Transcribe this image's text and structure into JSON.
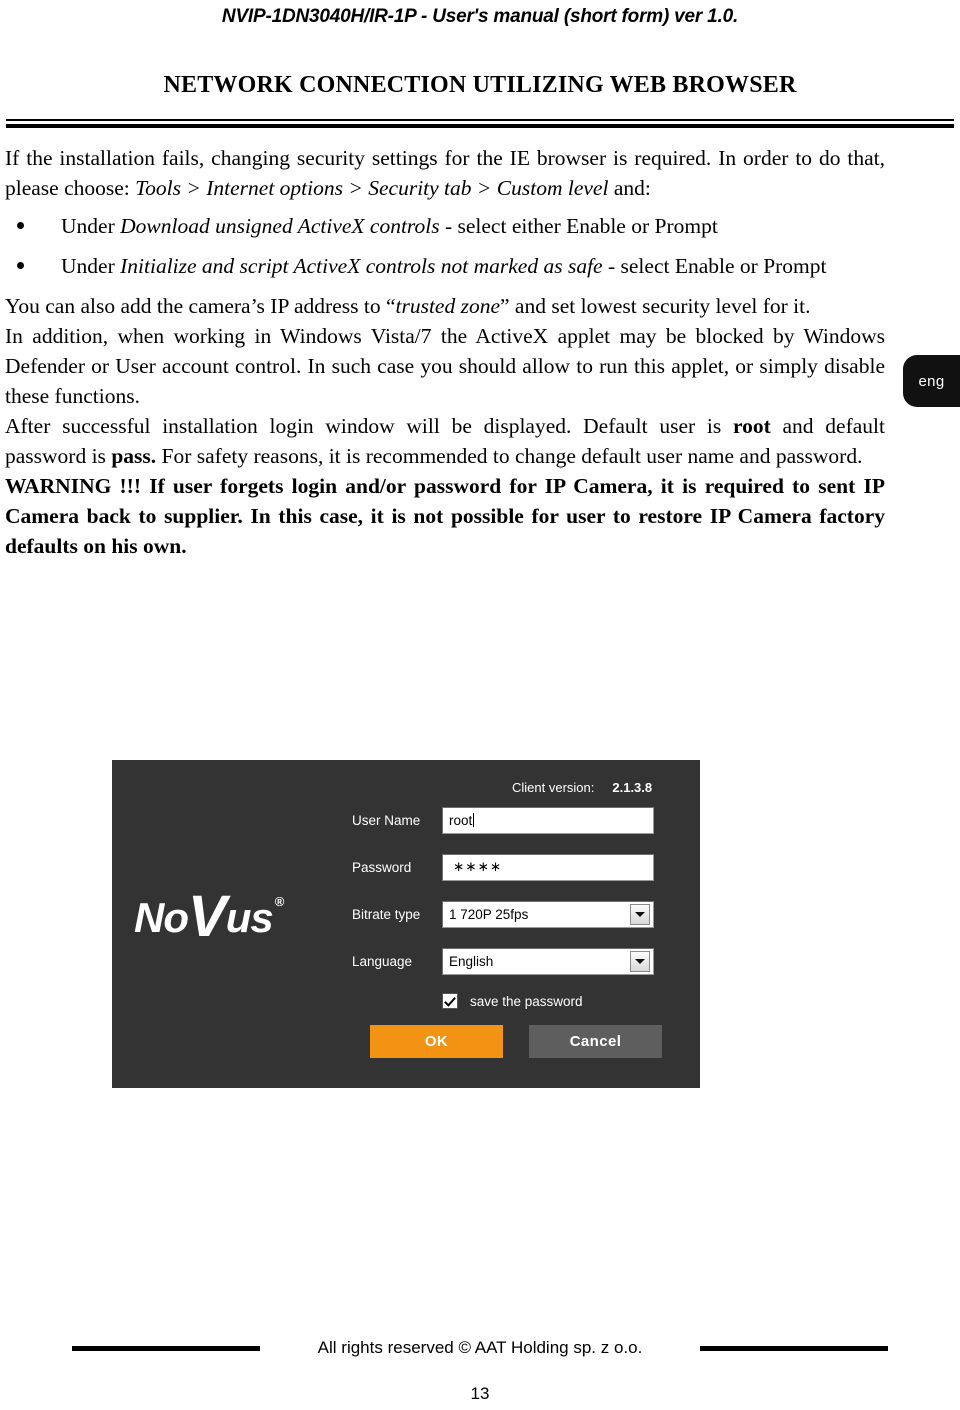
{
  "header": {
    "running_title": "NVIP-1DN3040H/IR-1P - User's manual (short form) ver 1.0."
  },
  "section": {
    "title": "NETWORK CONNECTION UTILIZING WEB BROWSER"
  },
  "body": {
    "intro_part1": "If the installation fails, changing security settings for the IE browser is required. In order to do that, please choose: ",
    "intro_menu_path": "Tools > Internet options > Security tab > Custom level",
    "intro_part2": " and:",
    "bullets": [
      {
        "prefix": "Under ",
        "emphasis": "Download unsigned ActiveX controls",
        "suffix": " - select either Enable or Prompt"
      },
      {
        "prefix": "Under ",
        "emphasis": "Initialize and script ActiveX controls not marked as safe",
        "suffix": " - select Enable or Prompt"
      }
    ],
    "trusted_zone_part1": "You can also add the camera’s IP address to “",
    "trusted_zone_emphasis": "trusted zone",
    "trusted_zone_part2": "” and set lowest security level for it.",
    "activex_block": "In addition, when working in Windows Vista/7 the ActiveX applet may be blocked by Windows Defender or User account control. In such case you should allow to run this applet, or simply disable these functions.",
    "login_info_part1": "After successful installation login window will be displayed. Default user is ",
    "login_info_user": "root",
    "login_info_part2": " and default password is ",
    "login_info_pass": "pass.",
    "login_info_part3": " For safety reasons, it is recommended to change default user name and password.",
    "warning_label": "WARNING !!!",
    "warning_text": "  If user forgets login and/or password for IP Camera, it is required to sent IP Camera back to supplier. In this case, it is not possible for user to restore IP Camera factory defaults on his own."
  },
  "lang_tab": {
    "label": "eng"
  },
  "login_dialog": {
    "client_version_label": "Client version:",
    "client_version_value": "2.1.3.8",
    "logo": {
      "part1": "No",
      "part2": "V",
      "part3": "us",
      "registered": "®"
    },
    "fields": [
      {
        "label": "User Name",
        "value": "root",
        "type": "text"
      },
      {
        "label": "Password",
        "value": "∗∗∗∗",
        "type": "password"
      },
      {
        "label": "Bitrate type",
        "value": "1 720P 25fps",
        "type": "select"
      },
      {
        "label": "Language",
        "value": "English",
        "type": "select"
      }
    ],
    "checkbox": {
      "label": "save the password",
      "checked": true
    },
    "buttons": {
      "ok": "OK",
      "cancel": "Cancel"
    },
    "colors": {
      "background": "#333333",
      "ok_button": "#f39313",
      "cancel_button": "#5e5e5e"
    }
  },
  "footer": {
    "copyright": "All rights reserved © AAT Holding sp. z o.o.",
    "page_number": "13"
  }
}
